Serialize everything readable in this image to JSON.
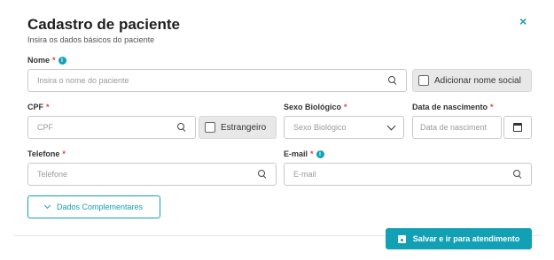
{
  "header": {
    "title": "Cadastro de paciente",
    "subtitle": "Insira os dados básicos do paciente",
    "close_icon": "×"
  },
  "fields": {
    "nome": {
      "label": "Nome",
      "required": "*",
      "placeholder": "Insira o nome do paciente"
    },
    "nome_social": {
      "label": "Adicionar nome social"
    },
    "cpf": {
      "label": "CPF",
      "required": "*",
      "placeholder": "CPF"
    },
    "estrangeiro": {
      "label": "Estrangeiro"
    },
    "sexo": {
      "label": "Sexo Biológico",
      "required": "*",
      "placeholder": "Sexo Biológico"
    },
    "nascimento": {
      "label": "Data de nascimento",
      "required": "*",
      "placeholder": "Data de nasciment"
    },
    "telefone": {
      "label": "Telefone",
      "required": "*",
      "placeholder": "Telefone"
    },
    "email": {
      "label": "E-mail",
      "required": "*",
      "placeholder": "E-mail"
    }
  },
  "actions": {
    "dados_complementares": "Dados Complementares",
    "salvar": "Salvar e ir para atendimento"
  },
  "icons": {
    "info": "i"
  },
  "colors": {
    "accent": "#11a0b4",
    "required": "#e0443e"
  }
}
